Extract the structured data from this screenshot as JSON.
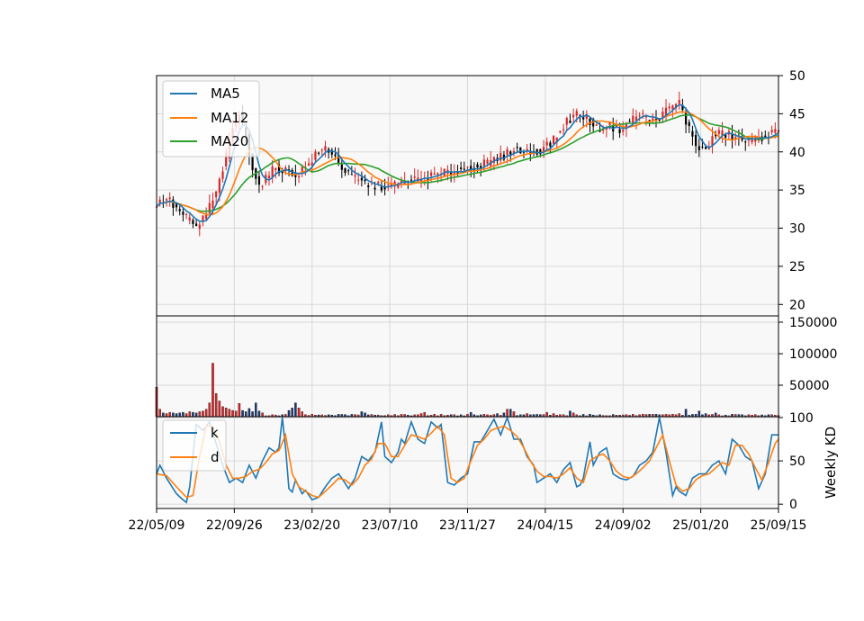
{
  "chart_data": [
    {
      "type": "candlestick",
      "panel": "price",
      "ylim": [
        18.5,
        50
      ],
      "yticks": [
        20,
        25,
        30,
        35,
        40,
        45,
        50
      ],
      "grid": true,
      "legend": {
        "placement": "top-left",
        "entries": [
          "MA5",
          "MA12",
          "MA20"
        ]
      },
      "colors": {
        "up": "#d62728",
        "down": "#000000",
        "MA5": "#1f77b4",
        "MA12": "#ff7f0e",
        "MA20": "#2ca02c",
        "background": "#f8f8f8",
        "grid": "#d9d9d9"
      },
      "close_anchors": [
        [
          0,
          33.0
        ],
        [
          3,
          34.0
        ],
        [
          6,
          32.5
        ],
        [
          10,
          31.0
        ],
        [
          12,
          30.0
        ],
        [
          15,
          32.0
        ],
        [
          18,
          34.5
        ],
        [
          21,
          39.5
        ],
        [
          23,
          43.0
        ],
        [
          25,
          45.0
        ],
        [
          27,
          42.0
        ],
        [
          29,
          38.0
        ],
        [
          31,
          35.5
        ],
        [
          33,
          36.5
        ],
        [
          36,
          38.0
        ],
        [
          39,
          37.5
        ],
        [
          42,
          37.0
        ],
        [
          45,
          38.0
        ],
        [
          48,
          39.5
        ],
        [
          51,
          40.5
        ],
        [
          53,
          40.0
        ],
        [
          55,
          38.5
        ],
        [
          58,
          37.0
        ],
        [
          62,
          36.0
        ],
        [
          66,
          35.5
        ],
        [
          70,
          35.5
        ],
        [
          75,
          36.0
        ],
        [
          80,
          36.5
        ],
        [
          85,
          37.0
        ],
        [
          90,
          37.5
        ],
        [
          95,
          38.0
        ],
        [
          100,
          38.5
        ],
        [
          105,
          39.5
        ],
        [
          108,
          40.5
        ],
        [
          110,
          40.0
        ],
        [
          115,
          40.0
        ],
        [
          120,
          41.5
        ],
        [
          124,
          44.0
        ],
        [
          127,
          45.0
        ],
        [
          130,
          44.5
        ],
        [
          133,
          43.0
        ],
        [
          136,
          43.5
        ],
        [
          140,
          43.0
        ],
        [
          143,
          44.0
        ],
        [
          146,
          45.0
        ],
        [
          150,
          44.0
        ],
        [
          153,
          45.0
        ],
        [
          156,
          46.0
        ],
        [
          158,
          46.5
        ],
        [
          160,
          44.0
        ],
        [
          163,
          41.0
        ],
        [
          166,
          40.0
        ],
        [
          168,
          42.0
        ],
        [
          171,
          42.5
        ],
        [
          174,
          42.0
        ],
        [
          177,
          41.5
        ],
        [
          180,
          41.5
        ],
        [
          183,
          42.0
        ],
        [
          186,
          42.5
        ],
        [
          188,
          42.5
        ]
      ]
    },
    {
      "type": "bar",
      "panel": "volume",
      "ylim": [
        0,
        160000
      ],
      "yticks": [
        50000,
        100000,
        150000
      ],
      "tick_labels": [
        "50000",
        "100000",
        "150000"
      ],
      "grid": true,
      "spikes": [
        [
          0,
          47000
        ],
        [
          1,
          12000
        ],
        [
          2,
          6000
        ],
        [
          3,
          5000
        ],
        [
          4,
          7000
        ],
        [
          5,
          6000
        ],
        [
          6,
          5000
        ],
        [
          7,
          6000
        ],
        [
          8,
          7000
        ],
        [
          9,
          5000
        ],
        [
          10,
          8000
        ],
        [
          11,
          7000
        ],
        [
          12,
          6000
        ],
        [
          13,
          8000
        ],
        [
          14,
          9000
        ],
        [
          15,
          12000
        ],
        [
          16,
          22000
        ],
        [
          17,
          85000
        ],
        [
          18,
          37000
        ],
        [
          19,
          25000
        ],
        [
          20,
          16000
        ],
        [
          21,
          14000
        ],
        [
          22,
          12000
        ],
        [
          23,
          10000
        ],
        [
          24,
          9000
        ],
        [
          25,
          21000
        ],
        [
          26,
          10000
        ],
        [
          27,
          8000
        ],
        [
          28,
          13000
        ],
        [
          29,
          8000
        ],
        [
          30,
          22000
        ],
        [
          31,
          9000
        ],
        [
          32,
          6000
        ],
        [
          40,
          10000
        ],
        [
          41,
          14000
        ],
        [
          42,
          22000
        ],
        [
          43,
          14000
        ],
        [
          44,
          8000
        ],
        [
          62,
          8000
        ],
        [
          63,
          6000
        ],
        [
          80,
          5000
        ],
        [
          81,
          7000
        ],
        [
          95,
          7000
        ],
        [
          103,
          5000
        ],
        [
          105,
          6000
        ],
        [
          106,
          12000
        ],
        [
          107,
          12000
        ],
        [
          108,
          8000
        ],
        [
          112,
          5000
        ],
        [
          118,
          7000
        ],
        [
          120,
          5000
        ],
        [
          125,
          9000
        ],
        [
          126,
          6000
        ],
        [
          158,
          5000
        ],
        [
          160,
          12000
        ],
        [
          163,
          4000
        ],
        [
          164,
          9000
        ],
        [
          166,
          5000
        ],
        [
          167,
          3000
        ],
        [
          169,
          6000
        ]
      ]
    },
    {
      "type": "line",
      "panel": "kd",
      "ylim": [
        -5,
        101
      ],
      "yticks": [
        0,
        50,
        100
      ],
      "ylabel": "Weekly KD",
      "grid": true,
      "legend": {
        "placement": "top-left",
        "entries": [
          "k",
          "d"
        ]
      },
      "colors": {
        "k": "#1f77b4",
        "d": "#ff7f0e"
      },
      "k_anchors": [
        [
          0,
          35
        ],
        [
          1,
          45
        ],
        [
          3,
          30
        ],
        [
          6,
          12
        ],
        [
          8,
          5
        ],
        [
          9,
          2
        ],
        [
          10,
          20
        ],
        [
          12,
          92
        ],
        [
          14,
          85
        ],
        [
          16,
          95
        ],
        [
          18,
          70
        ],
        [
          20,
          45
        ],
        [
          22,
          25
        ],
        [
          24,
          30
        ],
        [
          26,
          25
        ],
        [
          28,
          45
        ],
        [
          30,
          30
        ],
        [
          32,
          50
        ],
        [
          34,
          65
        ],
        [
          36,
          60
        ],
        [
          37,
          65
        ],
        [
          38,
          100
        ],
        [
          39,
          65
        ],
        [
          40,
          18
        ],
        [
          41,
          14
        ],
        [
          42,
          28
        ],
        [
          44,
          12
        ],
        [
          45,
          16
        ],
        [
          47,
          5
        ],
        [
          49,
          8
        ],
        [
          51,
          20
        ],
        [
          53,
          30
        ],
        [
          55,
          35
        ],
        [
          56,
          30
        ],
        [
          58,
          18
        ],
        [
          60,
          30
        ],
        [
          62,
          55
        ],
        [
          64,
          50
        ],
        [
          66,
          60
        ],
        [
          68,
          95
        ],
        [
          69,
          55
        ],
        [
          71,
          48
        ],
        [
          73,
          60
        ],
        [
          74,
          75
        ],
        [
          75,
          70
        ],
        [
          77,
          95
        ],
        [
          79,
          75
        ],
        [
          81,
          70
        ],
        [
          83,
          95
        ],
        [
          85,
          88
        ],
        [
          86,
          92
        ],
        [
          88,
          25
        ],
        [
          90,
          22
        ],
        [
          92,
          30
        ],
        [
          94,
          35
        ],
        [
          96,
          72
        ],
        [
          98,
          72
        ],
        [
          100,
          85
        ],
        [
          102,
          98
        ],
        [
          104,
          80
        ],
        [
          106,
          100
        ],
        [
          108,
          75
        ],
        [
          110,
          75
        ],
        [
          112,
          55
        ],
        [
          114,
          45
        ],
        [
          115,
          25
        ],
        [
          117,
          30
        ],
        [
          119,
          35
        ],
        [
          121,
          25
        ],
        [
          123,
          40
        ],
        [
          125,
          48
        ],
        [
          127,
          20
        ],
        [
          128,
          22
        ],
        [
          129,
          30
        ],
        [
          131,
          72
        ],
        [
          132,
          45
        ],
        [
          134,
          60
        ],
        [
          136,
          65
        ],
        [
          138,
          35
        ],
        [
          140,
          30
        ],
        [
          142,
          28
        ],
        [
          144,
          32
        ],
        [
          146,
          45
        ],
        [
          148,
          50
        ],
        [
          150,
          60
        ],
        [
          152,
          100
        ],
        [
          154,
          60
        ],
        [
          156,
          10
        ],
        [
          157,
          20
        ],
        [
          158,
          15
        ],
        [
          160,
          10
        ],
        [
          162,
          30
        ],
        [
          164,
          35
        ],
        [
          166,
          35
        ],
        [
          168,
          45
        ],
        [
          170,
          50
        ],
        [
          172,
          35
        ],
        [
          174,
          75
        ],
        [
          176,
          68
        ],
        [
          178,
          55
        ],
        [
          180,
          50
        ],
        [
          182,
          18
        ],
        [
          184,
          35
        ],
        [
          186,
          80
        ],
        [
          188,
          80
        ]
      ],
      "d_anchors": [
        [
          0,
          35
        ],
        [
          3,
          33
        ],
        [
          6,
          20
        ],
        [
          9,
          8
        ],
        [
          11,
          10
        ],
        [
          13,
          55
        ],
        [
          15,
          90
        ],
        [
          17,
          90
        ],
        [
          19,
          72
        ],
        [
          21,
          45
        ],
        [
          23,
          30
        ],
        [
          25,
          30
        ],
        [
          27,
          32
        ],
        [
          29,
          38
        ],
        [
          31,
          40
        ],
        [
          33,
          48
        ],
        [
          35,
          58
        ],
        [
          37,
          62
        ],
        [
          39,
          80
        ],
        [
          41,
          35
        ],
        [
          43,
          20
        ],
        [
          45,
          15
        ],
        [
          47,
          10
        ],
        [
          49,
          8
        ],
        [
          51,
          15
        ],
        [
          53,
          22
        ],
        [
          55,
          30
        ],
        [
          57,
          28
        ],
        [
          59,
          22
        ],
        [
          61,
          30
        ],
        [
          63,
          45
        ],
        [
          65,
          52
        ],
        [
          67,
          70
        ],
        [
          69,
          70
        ],
        [
          71,
          55
        ],
        [
          73,
          55
        ],
        [
          75,
          68
        ],
        [
          77,
          80
        ],
        [
          79,
          78
        ],
        [
          81,
          75
        ],
        [
          83,
          82
        ],
        [
          85,
          90
        ],
        [
          87,
          80
        ],
        [
          89,
          30
        ],
        [
          91,
          25
        ],
        [
          93,
          30
        ],
        [
          95,
          50
        ],
        [
          97,
          68
        ],
        [
          99,
          75
        ],
        [
          101,
          85
        ],
        [
          103,
          88
        ],
        [
          105,
          90
        ],
        [
          107,
          85
        ],
        [
          109,
          78
        ],
        [
          111,
          65
        ],
        [
          113,
          50
        ],
        [
          115,
          38
        ],
        [
          117,
          32
        ],
        [
          119,
          32
        ],
        [
          121,
          30
        ],
        [
          123,
          35
        ],
        [
          125,
          42
        ],
        [
          127,
          30
        ],
        [
          129,
          25
        ],
        [
          131,
          50
        ],
        [
          133,
          55
        ],
        [
          135,
          58
        ],
        [
          137,
          50
        ],
        [
          139,
          38
        ],
        [
          141,
          32
        ],
        [
          143,
          30
        ],
        [
          145,
          35
        ],
        [
          147,
          42
        ],
        [
          149,
          50
        ],
        [
          151,
          65
        ],
        [
          153,
          80
        ],
        [
          155,
          50
        ],
        [
          157,
          22
        ],
        [
          159,
          15
        ],
        [
          161,
          18
        ],
        [
          163,
          28
        ],
        [
          165,
          33
        ],
        [
          167,
          35
        ],
        [
          169,
          42
        ],
        [
          171,
          48
        ],
        [
          173,
          45
        ],
        [
          175,
          68
        ],
        [
          177,
          68
        ],
        [
          179,
          58
        ],
        [
          181,
          42
        ],
        [
          183,
          28
        ],
        [
          185,
          48
        ],
        [
          187,
          70
        ],
        [
          188,
          75
        ]
      ]
    }
  ],
  "x_axis": {
    "n_weeks": 189,
    "ticks": [
      "22/05/09",
      "22/09/26",
      "23/02/20",
      "23/07/10",
      "23/11/27",
      "24/04/15",
      "24/09/02",
      "25/01/20",
      "25/09/15"
    ]
  }
}
